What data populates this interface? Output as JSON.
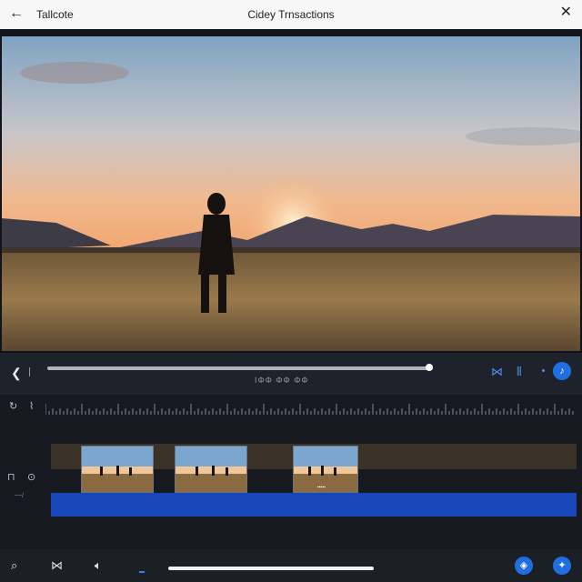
{
  "topbar": {
    "back_icon": "arrow-left-icon",
    "app_title": "Tallcote",
    "doc_title": "Cidey Trnsactions",
    "close_icon": "close-icon"
  },
  "preview": {
    "image": "silhouette-of-person-in-wheat-field-at-sunset"
  },
  "transport": {
    "prev_icon": "skip-back-icon",
    "progress": 0.99,
    "timecode": "ΙΦΦ ΦΦ ΦΦ",
    "buttons": [
      "bowtie-icon",
      "bars-icon",
      "dot-icon",
      "audio-circle-icon"
    ]
  },
  "timeline": {
    "tools": [
      "rotate-icon",
      "marker-icon",
      "split-icon",
      "link-icon"
    ],
    "track_label": "~~/",
    "clips": [
      {
        "name": "clip-1",
        "thumbnail": "people-in-field-at-sunset"
      },
      {
        "name": "clip-2",
        "thumbnail": "people-in-field-at-sunset"
      },
      {
        "name": "clip-3",
        "thumbnail": "people-in-field-at-sunset"
      }
    ],
    "clip3_caption": "▪▪▪▪▪"
  },
  "bottombar": {
    "icons": [
      "search-icon",
      "transition-icon",
      "volume-icon"
    ],
    "right_buttons": [
      "shield-icon",
      "magic-icon"
    ]
  },
  "colors": {
    "accent": "#1f6fe0",
    "audio_track": "#1646b8",
    "clip_lane": "#3a3226",
    "topbar": "#f7f7f7"
  }
}
